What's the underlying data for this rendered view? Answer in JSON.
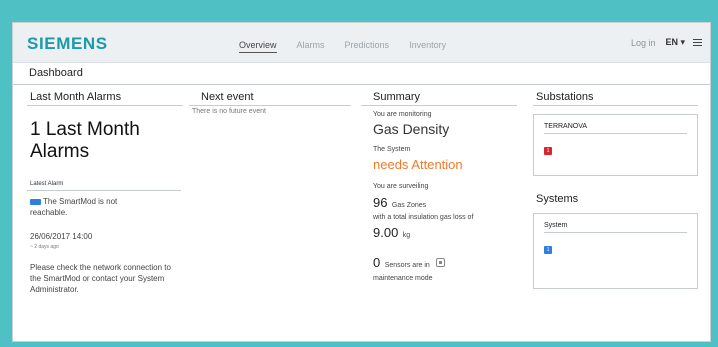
{
  "brand": {
    "logo": "SIEMENS"
  },
  "nav": {
    "items": [
      "Overview",
      "Alarms",
      "Predictions",
      "Inventory"
    ]
  },
  "topbar": {
    "login": "Log in",
    "language": "EN ▾"
  },
  "dashboard": {
    "title": "Dashboard"
  },
  "last_month": {
    "header": "Last Month Alarms",
    "big_text": "1 Last Month Alarms",
    "latest_label": "Latest Alarm",
    "message": "The SmartMod is not reachable.",
    "date": "26/06/2017 14:00",
    "ago": "~ 2 days ago",
    "help": "Please check the network connection to the SmartMod or contact your System Administrator."
  },
  "next_event": {
    "header": "Next event",
    "empty": "There is no future event"
  },
  "summary": {
    "header": "Summary",
    "monitoring_label": "You are monitoring",
    "monitoring_value": "Gas Density",
    "system_label": "The System",
    "system_status": "needs Attention",
    "surveiling_label": "You are surveiling",
    "zones_count": "96",
    "zones_unit": "Gas Zones",
    "loss_label": "with a total insulation gas loss of",
    "loss_value": "9.00",
    "loss_unit": "kg",
    "sensors_count": "0",
    "sensors_text": "Sensors are in",
    "maintenance_text": "maintenance mode"
  },
  "substations": {
    "header": "Substations",
    "card_title": "TERRANOVA",
    "badge": "1"
  },
  "systems": {
    "header": "Systems",
    "card_title": "System",
    "badge": "1"
  },
  "colors": {
    "brand": "#1b9aa8",
    "alert_orange": "#f07a2b",
    "badge_red": "#d8262e",
    "badge_blue": "#2f7fdc",
    "frame_teal": "#4fc0c4"
  }
}
